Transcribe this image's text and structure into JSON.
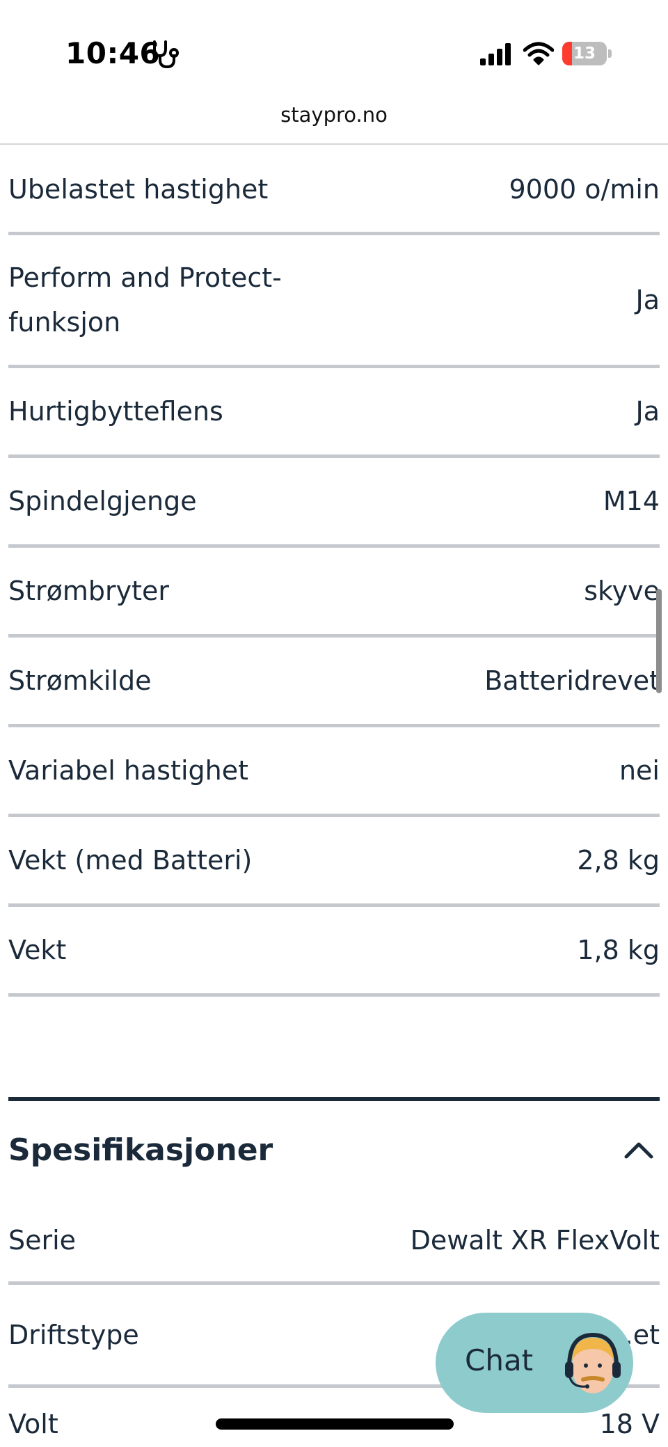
{
  "status_bar": {
    "time": "10:46",
    "battery_level": "13",
    "battery_fraction": 0.13,
    "colors": {
      "battery_low": "#ff3b30"
    }
  },
  "browser": {
    "url": "staypro.no"
  },
  "specs_top": [
    {
      "label": "Ubelastet hastighet",
      "value": "9000 o/min"
    },
    {
      "label": "Perform and Protect-funksjon",
      "value": "Ja"
    },
    {
      "label": "Hurtigbytteflens",
      "value": "Ja"
    },
    {
      "label": "Spindelgjenge",
      "value": "M14"
    },
    {
      "label": "Strømbryter",
      "value": "skyve"
    },
    {
      "label": "Strømkilde",
      "value": "Batteridrevet"
    },
    {
      "label": "Variabel hastighet",
      "value": "nei"
    },
    {
      "label": "Vekt (med Batteri)",
      "value": "2,8 kg"
    },
    {
      "label": "Vekt",
      "value": "1,8 kg"
    }
  ],
  "section": {
    "title": "Spesifikasjoner",
    "toggle_icon": "chevron-up-icon",
    "rows": [
      {
        "label": "Serie",
        "value": "Dewalt XR FlexVolt"
      },
      {
        "label": "Driftstype",
        "value": "...et"
      },
      {
        "label": "Volt",
        "value": "18 V"
      }
    ]
  },
  "chat": {
    "label": "Chat",
    "avatar_icon": "support-agent-avatar"
  },
  "colors": {
    "text": "#1b2a3a",
    "divider": "#c5c9ce",
    "chat_bg": "#8ecbcc"
  }
}
